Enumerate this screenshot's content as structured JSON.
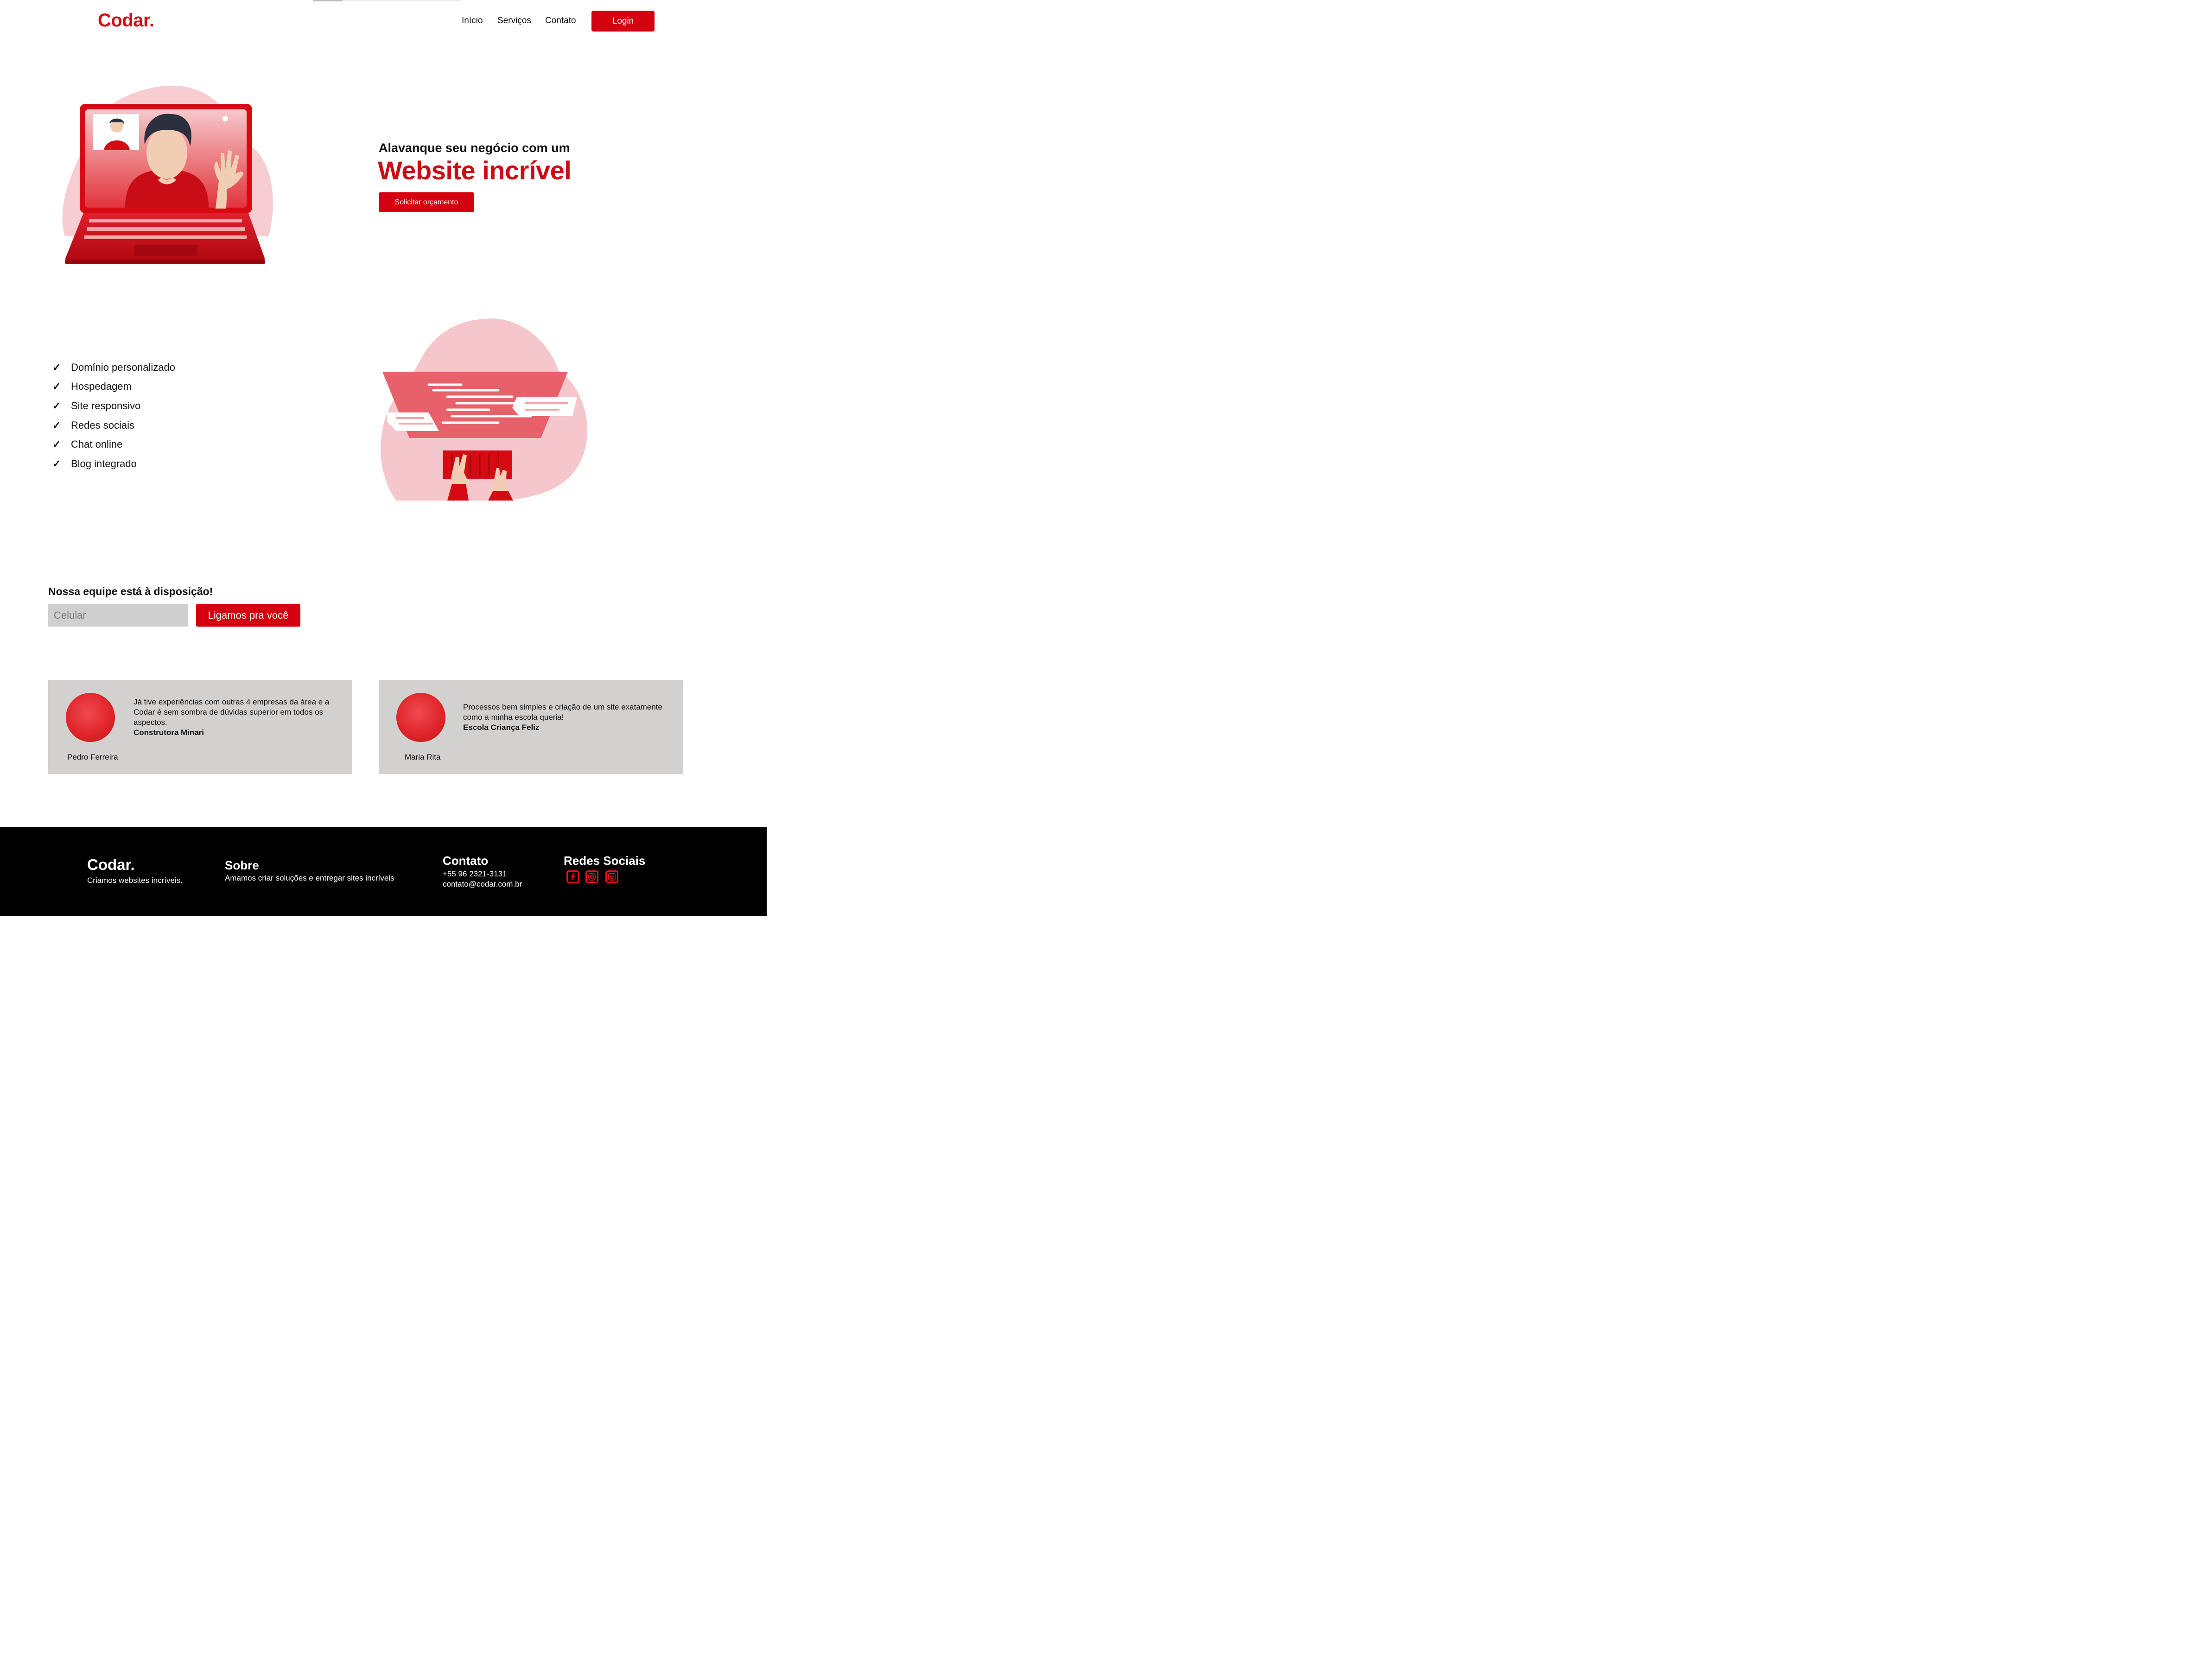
{
  "header": {
    "logo": "Codar.",
    "nav": [
      "Início",
      "Serviços",
      "Contato"
    ],
    "login_label": "Login"
  },
  "hero": {
    "subtitle": "Alavanque seu negócio com um",
    "title": "Website incrível",
    "cta_label": "Solicitar orçamento"
  },
  "features": {
    "check_glyph": "✓",
    "items": [
      "Domínio personalizado",
      "Hospedagem",
      "Site responsivo",
      "Redes sociais",
      "Chat online",
      "Blog integrado"
    ]
  },
  "call": {
    "title": "Nossa equipe está à disposição!",
    "phone_placeholder": "Celular",
    "button_label": "Ligamos pra você"
  },
  "testimonials": [
    {
      "text": "Já tive experiências com outras 4 empresas da área e a Codar é sem sombra de dúvidas superior em todos os aspectos.",
      "company": "Construtora Minari",
      "name": "Pedro Ferreira"
    },
    {
      "text": "Processos bem simples e criação de um site exatamente como a minha escola queria!",
      "company": "Escola Criança Feliz",
      "name": "Maria Rita"
    }
  ],
  "footer": {
    "logo": "Codar.",
    "tagline": "Criamos websites incríveis.",
    "about_title": "Sobre",
    "about_text": "Amamos criar soluções e entregar sites incríveis",
    "contact_title": "Contato",
    "phone": "+55 96 2321-3131",
    "email": "contato@codar.com.br",
    "social_title": "Redes Sociais",
    "social_icons": [
      "facebook-icon",
      "instagram-icon",
      "instagram-alt-icon"
    ]
  },
  "colors": {
    "brand_red": "#d4000f",
    "footer_bg": "#000000",
    "card_bg": "#d3d0d0",
    "blob_pink": "#f5c6cb"
  }
}
